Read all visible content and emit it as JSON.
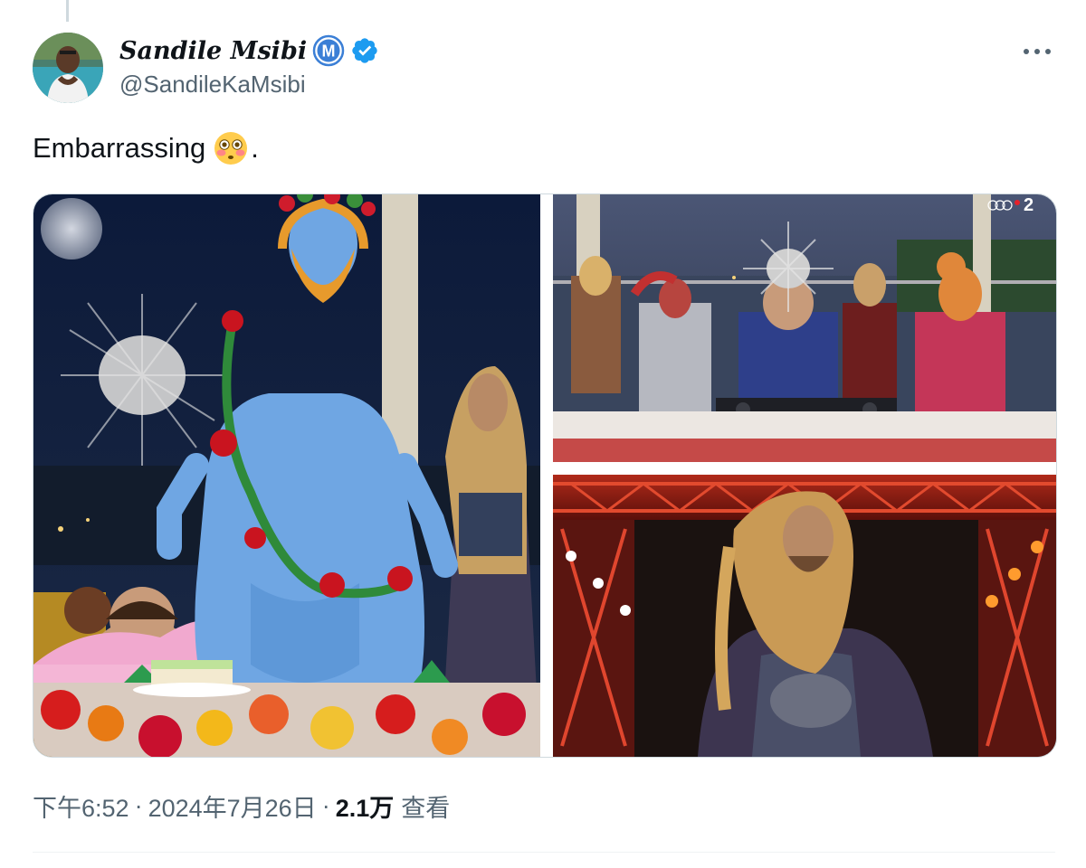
{
  "author": {
    "display_name": "Sandile Msibi",
    "handle": "@SandileKaMsibi",
    "affiliate_badge_letter": "M",
    "verified": true,
    "avatar_icon": "profile-photo"
  },
  "tweet": {
    "text": "Embarrassing",
    "emoji": "flushed-face",
    "trailing": "."
  },
  "media": {
    "count": 3,
    "items": [
      {
        "slot": "left",
        "alt": ""
      },
      {
        "slot": "top-right",
        "alt": "",
        "overlay_text": "2"
      },
      {
        "slot": "bottom-right",
        "alt": ""
      }
    ]
  },
  "meta": {
    "time": "下午6:52",
    "separator": "·",
    "date": "2024年7月26日",
    "views_count": "2.1万",
    "views_label": "查看"
  },
  "colors": {
    "text_primary": "#0f1419",
    "text_secondary": "#536471",
    "verified_blue": "#1d9bf0",
    "affiliate_blue": "#3b7fd6",
    "border": "#cfd9de"
  },
  "icons": {
    "more": "more-dots-icon",
    "verified": "verified-check-icon",
    "affiliate": "affiliate-m-icon"
  }
}
